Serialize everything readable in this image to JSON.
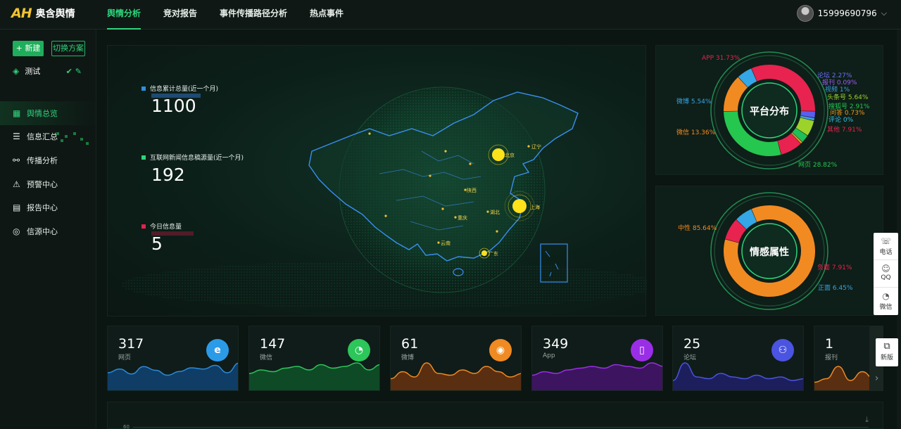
{
  "app": {
    "logo_mark": "AH",
    "logo_text": "奥含舆情"
  },
  "nav": [
    {
      "label": "舆情分析",
      "active": true
    },
    {
      "label": "竞对报告",
      "active": false
    },
    {
      "label": "事件传播路径分析",
      "active": false
    },
    {
      "label": "热点事件",
      "active": false
    }
  ],
  "user": {
    "phone": "15999690796"
  },
  "sidebar": {
    "new_label": "+ 新建",
    "switch_label": "切换方案",
    "plan_name": "测试",
    "menu": [
      {
        "label": "舆情总览",
        "icon": "dashboard-icon",
        "glyph": "▦",
        "active": true
      },
      {
        "label": "信息汇总",
        "icon": "list-icon",
        "glyph": "☰",
        "active": false
      },
      {
        "label": "传播分析",
        "icon": "share-icon",
        "glyph": "⚯",
        "active": false
      },
      {
        "label": "预警中心",
        "icon": "alarm-icon",
        "glyph": "⚠",
        "active": false
      },
      {
        "label": "报告中心",
        "icon": "report-icon",
        "glyph": "▤",
        "active": false
      },
      {
        "label": "信源中心",
        "icon": "target-icon",
        "glyph": "◎",
        "active": false
      }
    ]
  },
  "stats": [
    {
      "label": "信息累计总量(近一个月)",
      "value": "1100",
      "color": "#2f8fe0"
    },
    {
      "label": "互联网新闻信息稿源量(近一个月)",
      "value": "192",
      "color": "#2fd57c"
    },
    {
      "label": "今日信息量",
      "value": "5",
      "color": "#e0234e"
    }
  ],
  "map_cities": [
    "北京",
    "辽宁",
    "陕西",
    "上海",
    "湖北",
    "重庆",
    "云南",
    "广东"
  ],
  "platform": {
    "title": "平台分布",
    "items": [
      {
        "label": "APP 31.73%",
        "value": 31.73,
        "color": "#e8234f"
      },
      {
        "label": "论坛 2.27%",
        "value": 2.27,
        "color": "#5a5ff0"
      },
      {
        "label": "报刊 0.09%",
        "value": 0.09,
        "color": "#8a3cf0"
      },
      {
        "label": "视频 1%",
        "value": 1.0,
        "color": "#3aa0e0"
      },
      {
        "label": "头条号 5.64%",
        "value": 5.64,
        "color": "#9cd22a"
      },
      {
        "label": "搜狐号 2.91%",
        "value": 2.91,
        "color": "#1fbf5a"
      },
      {
        "label": "问答 0.73%",
        "value": 0.73,
        "color": "#f39a1a"
      },
      {
        "label": "评论 0%",
        "value": 0.0,
        "color": "#33c4e6"
      },
      {
        "label": "其他 7.91%",
        "value": 7.91,
        "color": "#e8234f"
      },
      {
        "label": "网页 28.82%",
        "value": 28.82,
        "color": "#25c74f"
      },
      {
        "label": "微信 13.36%",
        "value": 13.36,
        "color": "#f28a22"
      },
      {
        "label": "微博 5.54%",
        "value": 5.54,
        "color": "#35a6e6"
      }
    ]
  },
  "sentiment": {
    "title": "情感属性",
    "items": [
      {
        "label": "中性 85.64%",
        "value": 85.64,
        "color": "#f28a22"
      },
      {
        "label": "负面 7.91%",
        "value": 7.91,
        "color": "#e8234f"
      },
      {
        "label": "正面 6.45%",
        "value": 6.45,
        "color": "#35a6e6"
      }
    ]
  },
  "cards": [
    {
      "value": "317",
      "name": "网页",
      "icon": "ie-icon",
      "glyph": "e",
      "icon_color": "#2b9be8",
      "line_color": "#2b8ad8",
      "fill": "#0f3d66",
      "series": [
        12,
        15,
        11,
        17,
        14,
        10,
        13,
        16,
        15,
        18,
        12,
        20
      ]
    },
    {
      "value": "147",
      "name": "微信",
      "icon": "wechat-icon",
      "glyph": "◔",
      "icon_color": "#2cc65a",
      "line_color": "#2cc65a",
      "fill": "#0f4a26",
      "series": [
        8,
        10,
        9,
        11,
        12,
        10,
        13,
        11,
        12,
        14,
        10,
        13
      ]
    },
    {
      "value": "61",
      "name": "微博",
      "icon": "weibo-icon",
      "glyph": "◉",
      "icon_color": "#f08a22",
      "line_color": "#f08a22",
      "fill": "#5a2e10",
      "series": [
        5,
        9,
        6,
        14,
        8,
        7,
        10,
        8,
        12,
        9,
        6,
        8
      ]
    },
    {
      "value": "349",
      "name": "App",
      "icon": "phone-icon",
      "glyph": "▯",
      "icon_color": "#9a2ee6",
      "line_color": "#9a2ee6",
      "fill": "#3d1460",
      "series": [
        7,
        9,
        8,
        10,
        11,
        12,
        11,
        13,
        12,
        11,
        14,
        12
      ]
    },
    {
      "value": "25",
      "name": "论坛",
      "icon": "group-icon",
      "glyph": "⚇",
      "icon_color": "#4a54e0",
      "line_color": "#4a54e0",
      "fill": "#1c1f5c",
      "series": [
        4,
        14,
        6,
        5,
        8,
        6,
        5,
        7,
        5,
        6,
        4,
        5
      ]
    },
    {
      "value": "1",
      "name": "报刊",
      "icon": "newspaper-icon",
      "glyph": "▤",
      "icon_color": "#e08020",
      "line_color": "#f08a22",
      "fill": "#5a2e10",
      "series": [
        3,
        5,
        12,
        4,
        9,
        5,
        14,
        6,
        4,
        5,
        3,
        4
      ]
    }
  ],
  "bottom": {
    "axis_value": "60"
  },
  "float": {
    "phone": "电话",
    "qq": "QQ",
    "wechat": "微信",
    "new_version": "新版"
  }
}
